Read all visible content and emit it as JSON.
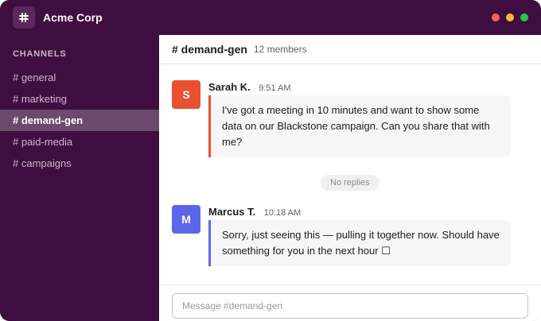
{
  "app": {
    "workspace_name": "Acme Corp",
    "icon": "slack-hash-icon",
    "window_controls": [
      {
        "name": "close",
        "color": "#ff5f57"
      },
      {
        "name": "minimize",
        "color": "#febc2e"
      },
      {
        "name": "maximize",
        "color": "#28c840"
      }
    ]
  },
  "colors": {
    "sidebar_bg": "#3f0e40",
    "active_item_bg": "#6b4a6d",
    "avatar_sarah": "#e8502f",
    "avatar_marcus": "#5b67e8"
  },
  "sidebar": {
    "heading": "CHANNELS",
    "channels": [
      {
        "label": "# general",
        "active": false
      },
      {
        "label": "# marketing",
        "active": false
      },
      {
        "label": "# demand-gen",
        "active": true
      },
      {
        "label": "# paid-media",
        "active": false
      },
      {
        "label": "# campaigns",
        "active": false
      }
    ]
  },
  "channel": {
    "title": "# demand-gen",
    "members": "12 members"
  },
  "messages": [
    {
      "avatar": "S",
      "author": "Sarah K.",
      "time": "9:51 AM",
      "text": "I've got a meeting in 10 minutes and want to show some data on our Blackstone campaign. Can you share that with me?"
    },
    {
      "avatar": "M",
      "author": "Marcus T.",
      "time": "10:18 AM",
      "text": "Sorry, just seeing this — pulling it together now. Should have something for you in the next hour ☐"
    }
  ],
  "thread_note": "No replies",
  "composer": {
    "placeholder": "Message #demand-gen"
  }
}
